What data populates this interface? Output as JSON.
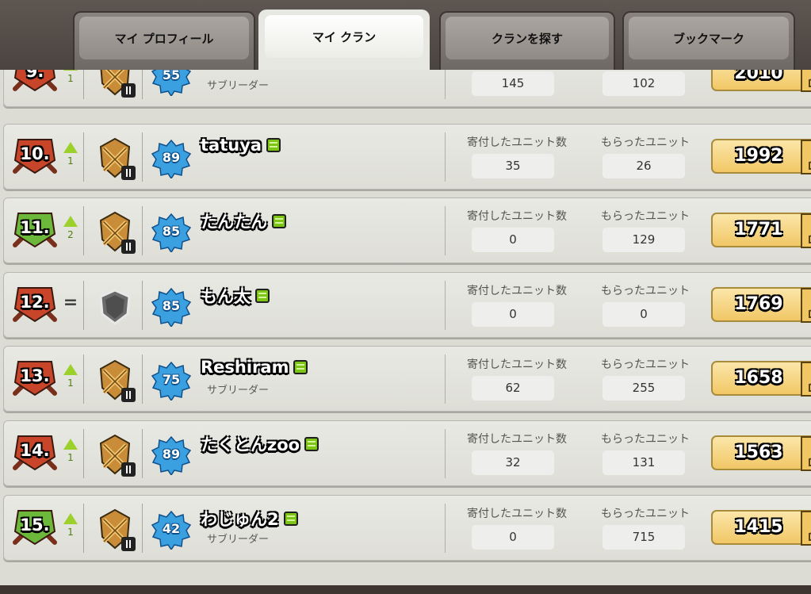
{
  "tabs": [
    {
      "label": "マイ プロフィール",
      "active": false
    },
    {
      "label": "マイ クラン",
      "active": true
    },
    {
      "label": "クランを探す",
      "active": false
    },
    {
      "label": "ブックマーク",
      "active": false
    }
  ],
  "labels": {
    "donated": "寄付したユニット数",
    "received": "もらったユニット"
  },
  "members": [
    {
      "rank": "9.",
      "trend": "up",
      "delta": "1",
      "xp": "55",
      "name": "",
      "online": false,
      "role": "サブリーダー",
      "donated": "145",
      "received": "102",
      "trophies": "2010",
      "badge": "red"
    },
    {
      "rank": "10.",
      "trend": "up",
      "delta": "1",
      "xp": "89",
      "name": "tatuya",
      "online": true,
      "role": "",
      "donated": "35",
      "received": "26",
      "trophies": "1992",
      "badge": "red"
    },
    {
      "rank": "11.",
      "trend": "up",
      "delta": "2",
      "xp": "85",
      "name": "たんたん",
      "online": true,
      "role": "",
      "donated": "0",
      "received": "129",
      "trophies": "1771",
      "badge": "green"
    },
    {
      "rank": "12.",
      "trend": "same",
      "delta": "",
      "xp": "85",
      "name": "もん太",
      "online": true,
      "role": "",
      "donated": "0",
      "received": "0",
      "trophies": "1769",
      "badge": "red"
    },
    {
      "rank": "13.",
      "trend": "up",
      "delta": "1",
      "xp": "75",
      "name": "Reshiram",
      "online": true,
      "role": "サブリーダー",
      "donated": "62",
      "received": "255",
      "trophies": "1658",
      "badge": "red"
    },
    {
      "rank": "14.",
      "trend": "up",
      "delta": "1",
      "xp": "89",
      "name": "たくとんzoo",
      "online": true,
      "role": "",
      "donated": "32",
      "received": "131",
      "trophies": "1563",
      "badge": "red"
    },
    {
      "rank": "15.",
      "trend": "up",
      "delta": "1",
      "xp": "42",
      "name": "わじゅん2",
      "online": true,
      "role": "サブリーダー",
      "donated": "0",
      "received": "715",
      "trophies": "1415",
      "badge": "green"
    }
  ],
  "colors": {
    "badge_red": "#c8452a",
    "badge_green": "#6cb83a",
    "trend_up": "#9bd12a",
    "xp_blue": "#3aa0e0",
    "trophy_gold": "#f1c766"
  }
}
